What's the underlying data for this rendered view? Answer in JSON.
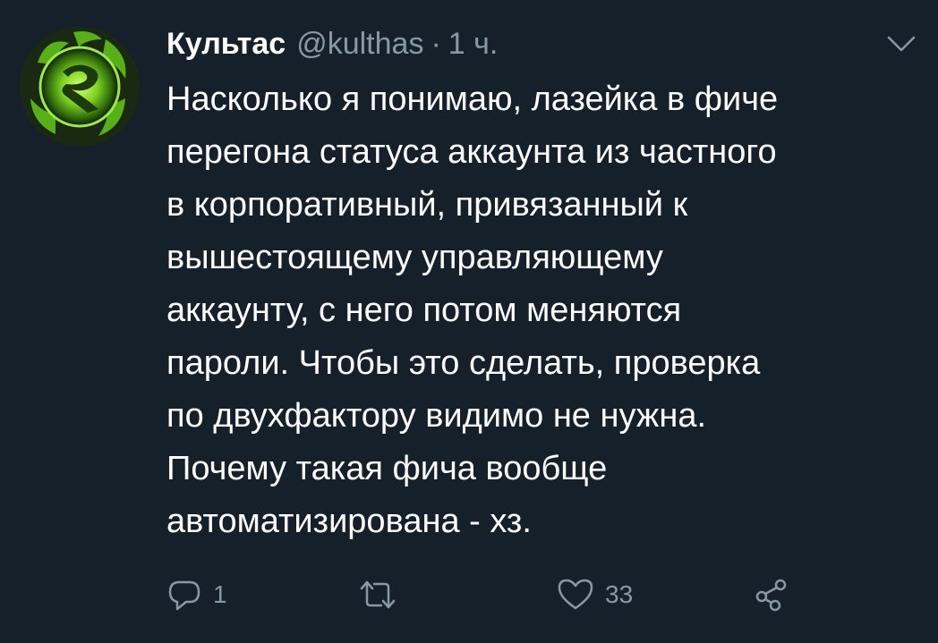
{
  "tweet": {
    "author_name": "Культас",
    "handle": "@kulthas",
    "separator": "·",
    "time": "1 ч.",
    "text_lines": [
      "Насколько я понимаю, лазейка в фиче",
      "перегона статуса аккаунта из частного",
      "в корпоративный, привязанный к",
      "вышестоящему управляющему",
      "аккаунту, с него потом меняются",
      "пароли. Чтобы это сделать, проверка",
      "по двухфактору видимо не нужна.",
      "Почему такая фича вообще",
      "автоматизирована - хз."
    ],
    "actions": {
      "reply": {
        "icon": "reply-icon",
        "count": "1"
      },
      "retweet": {
        "icon": "retweet-icon",
        "count": ""
      },
      "like": {
        "icon": "heart-icon",
        "count": "33"
      },
      "share": {
        "icon": "share-icon"
      }
    },
    "more_icon": "chevron-down-icon",
    "avatar_icon": "green-flame-emblem"
  },
  "colors": {
    "background": "#15202b",
    "text_primary": "#ffffff",
    "text_secondary": "#8899a6",
    "avatar_accent": "#7ed321"
  }
}
